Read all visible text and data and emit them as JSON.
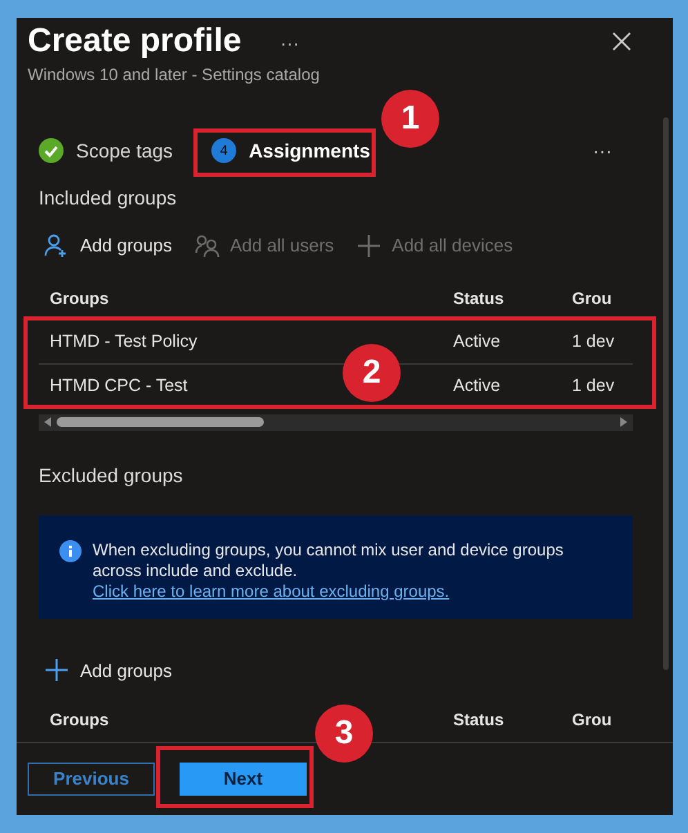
{
  "window": {
    "title": "Create profile",
    "more": "···",
    "subtitle": "Windows 10 and later - Settings catalog"
  },
  "tabs": [
    {
      "label": "Scope tags",
      "completed": true,
      "selected": false
    },
    {
      "label": "Assignments",
      "step": "4",
      "completed": false,
      "selected": true
    }
  ],
  "tabs_more": "···",
  "included": {
    "heading": "Included groups",
    "actions": [
      {
        "label": "Add groups",
        "kind": "add-group",
        "disabled": false
      },
      {
        "label": "Add all users",
        "kind": "users",
        "disabled": true
      },
      {
        "label": "Add all devices",
        "kind": "plus",
        "disabled": true
      }
    ],
    "table": {
      "columns": [
        "Groups",
        "Status",
        "Grou"
      ],
      "rows": [
        [
          "HTMD - Test Policy",
          "Active",
          "1 dev"
        ],
        [
          "HTMD CPC - Test",
          "Active",
          "1 dev"
        ]
      ]
    }
  },
  "excluded": {
    "heading": "Excluded groups",
    "info": {
      "text": "When excluding groups, you cannot mix user and device groups across include and exclude.",
      "link": "Click here to learn more about excluding groups."
    },
    "actions": [
      {
        "label": "Add groups",
        "kind": "plus",
        "disabled": false
      }
    ],
    "table": {
      "columns": [
        "Groups",
        "Status",
        "Grou"
      ]
    }
  },
  "footer": {
    "buttons": [
      {
        "label": "Previous",
        "kind": "secondary"
      },
      {
        "label": "Next",
        "kind": "primary"
      }
    ]
  },
  "callouts": [
    {
      "number": "1"
    },
    {
      "number": "2"
    },
    {
      "number": "3"
    }
  ]
}
